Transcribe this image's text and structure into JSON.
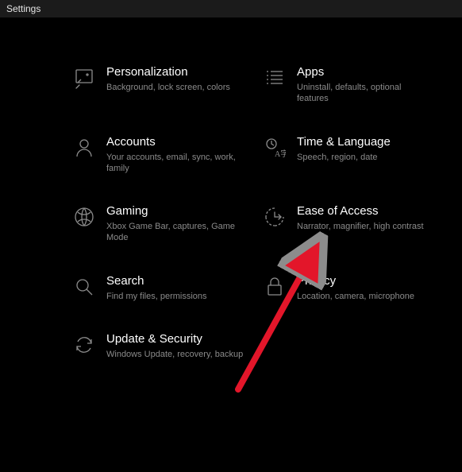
{
  "window": {
    "title": "Settings"
  },
  "tiles": {
    "personalization": {
      "title": "Personalization",
      "sub": "Background, lock screen, colors"
    },
    "apps": {
      "title": "Apps",
      "sub": "Uninstall, defaults, optional features"
    },
    "accounts": {
      "title": "Accounts",
      "sub": "Your accounts, email, sync, work, family"
    },
    "time": {
      "title": "Time & Language",
      "sub": "Speech, region, date"
    },
    "gaming": {
      "title": "Gaming",
      "sub": "Xbox Game Bar, captures, Game Mode"
    },
    "ease": {
      "title": "Ease of Access",
      "sub": "Narrator, magnifier, high contrast"
    },
    "search": {
      "title": "Search",
      "sub": "Find my files, permissions"
    },
    "privacy": {
      "title": "Privacy",
      "sub": "Location, camera, microphone"
    },
    "update": {
      "title": "Update & Security",
      "sub": "Windows Update, recovery, backup"
    }
  },
  "annotation": {
    "arrow_color": "#e3162a"
  }
}
